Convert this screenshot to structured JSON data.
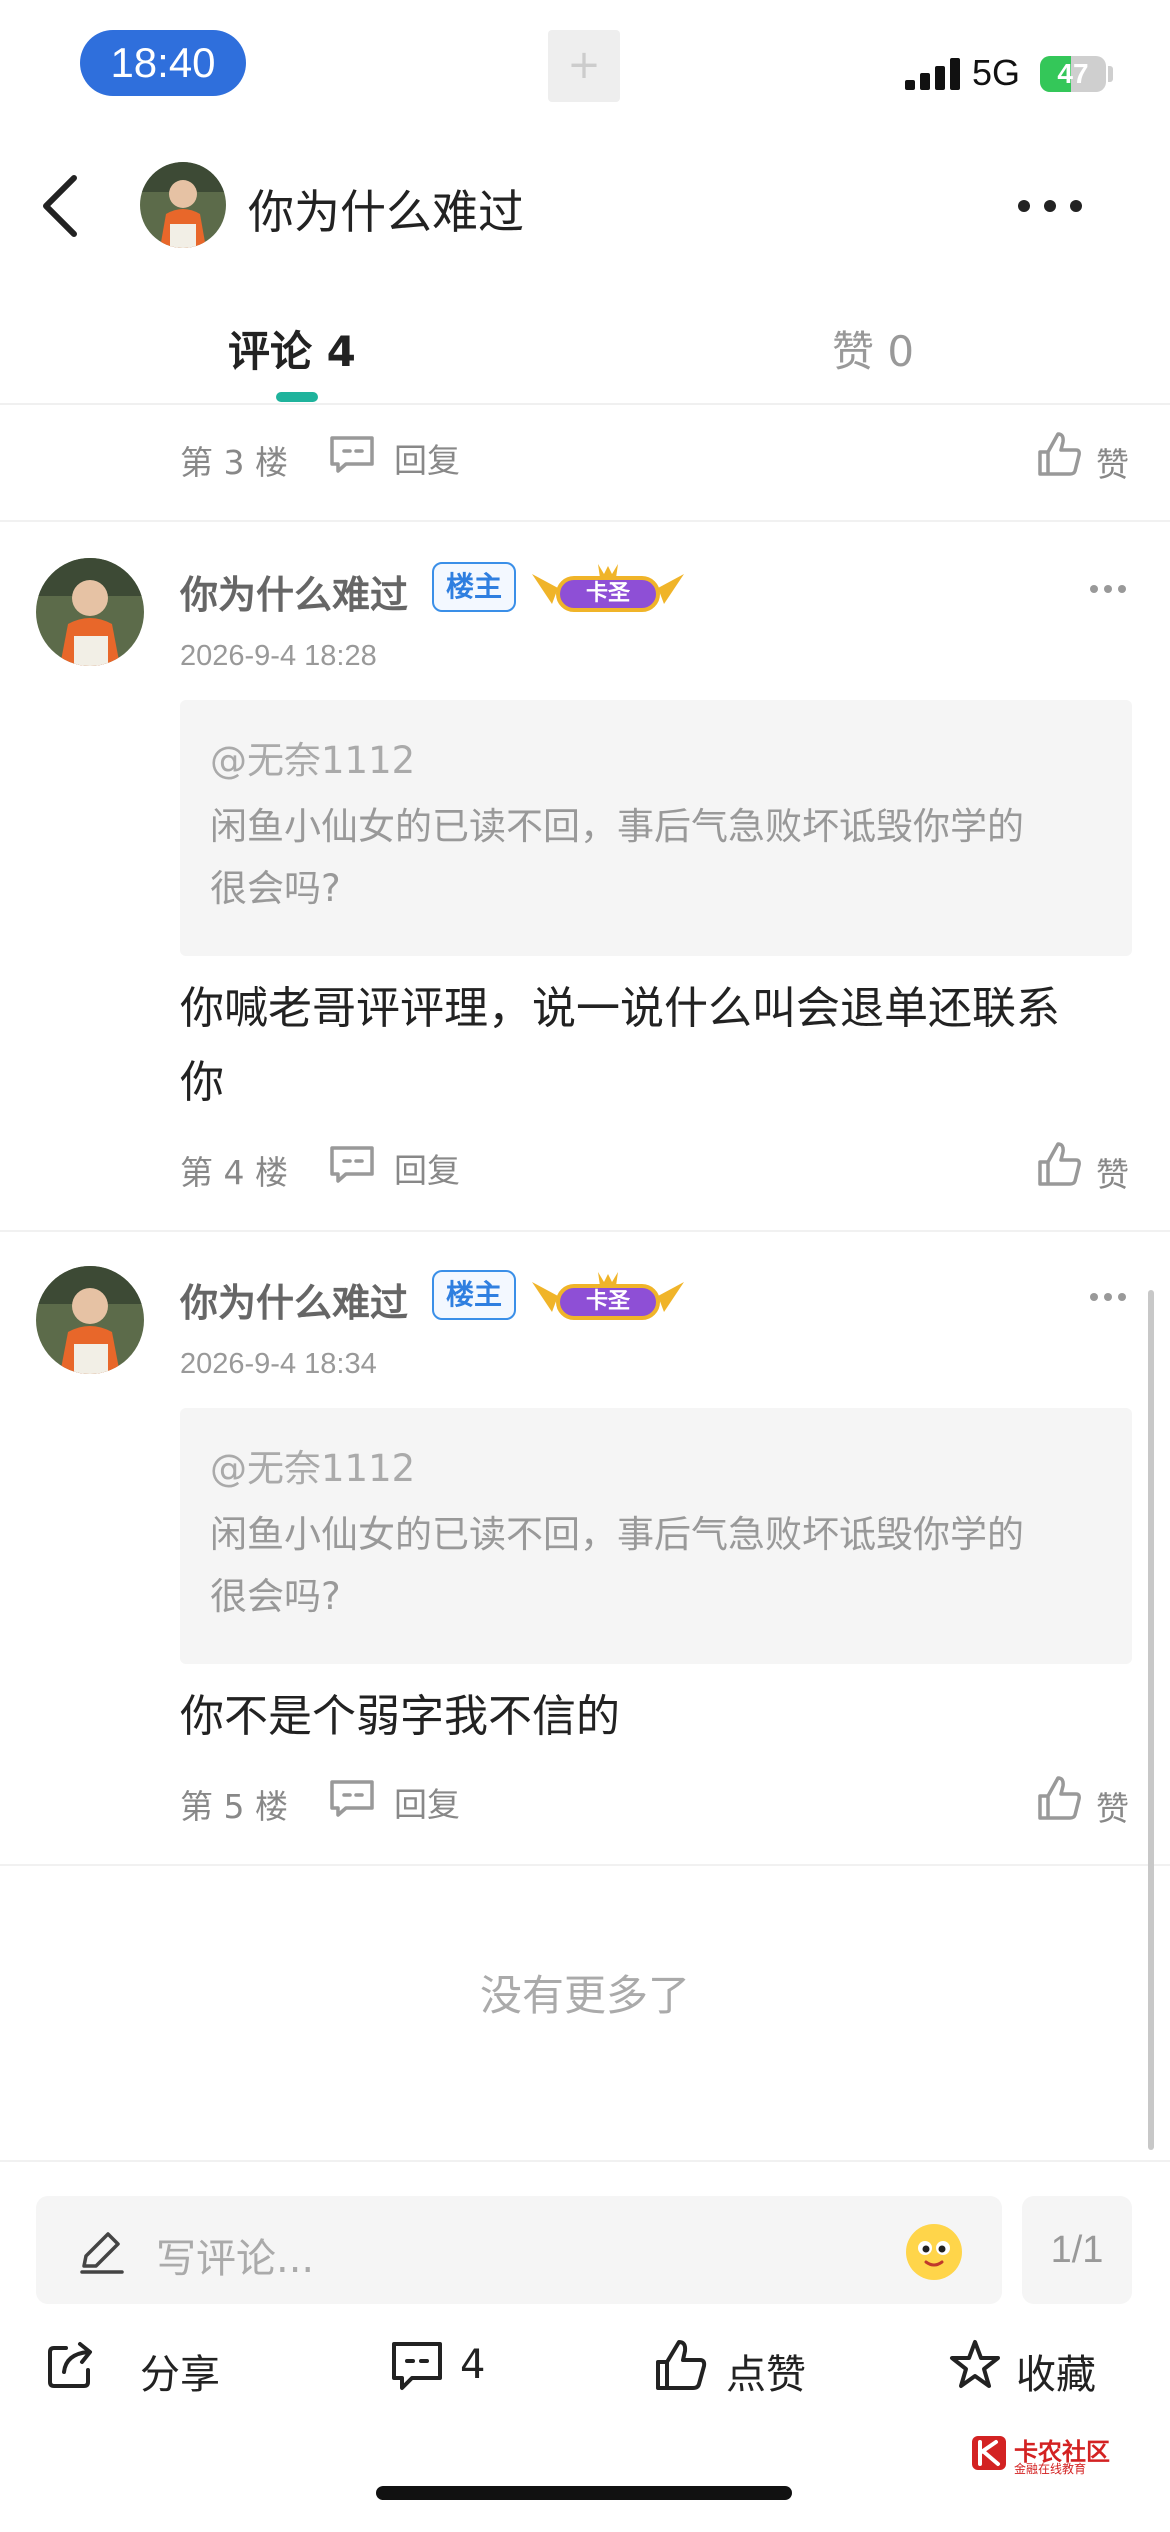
{
  "status_bar": {
    "time": "18:40",
    "network": "5G",
    "battery": "47",
    "battery_fraction": 0.47
  },
  "header": {
    "title": "你为什么难过"
  },
  "tabs": [
    {
      "label": "评论 4",
      "active": true
    },
    {
      "label": "赞 0",
      "active": false
    }
  ],
  "labels": {
    "reply": "回复",
    "like": "赞",
    "op_badge": "楼主",
    "rank_badge": "卡圣"
  },
  "partial_comment": {
    "floor": "第 3 楼"
  },
  "comments": [
    {
      "author": "你为什么难过",
      "timestamp": "2026-9-4 18:28",
      "quote_user": "@无奈1112",
      "quote_lines": [
        "闲鱼小仙女的已读不回，事后气急败坏诋毁你学的",
        "很会吗?"
      ],
      "body_lines": [
        "你喊老哥评评理，说一说什么叫会退单还联系",
        "你"
      ],
      "floor": "第 4 楼"
    },
    {
      "author": "你为什么难过",
      "timestamp": "2026-9-4 18:34",
      "quote_user": "@无奈1112",
      "quote_lines": [
        "闲鱼小仙女的已读不回，事后气急败坏诋毁你学的",
        "很会吗?"
      ],
      "body_lines": [
        "你不是个弱字我不信的"
      ],
      "floor": "第 5 楼"
    }
  ],
  "no_more": "没有更多了",
  "input": {
    "placeholder": "写评论...",
    "page": "1/1"
  },
  "actions": {
    "share": "分享",
    "comments": "4",
    "like": "点赞",
    "favorite": "收藏"
  },
  "watermark": {
    "title": "卡农社区",
    "subtitle": "金融在线教育"
  },
  "colors": {
    "accent": "#1fb39c",
    "time_pill": "#2f6fdc",
    "battery": "#34c759",
    "op_badge": "#2f7fe0",
    "watermark": "#d32222"
  }
}
